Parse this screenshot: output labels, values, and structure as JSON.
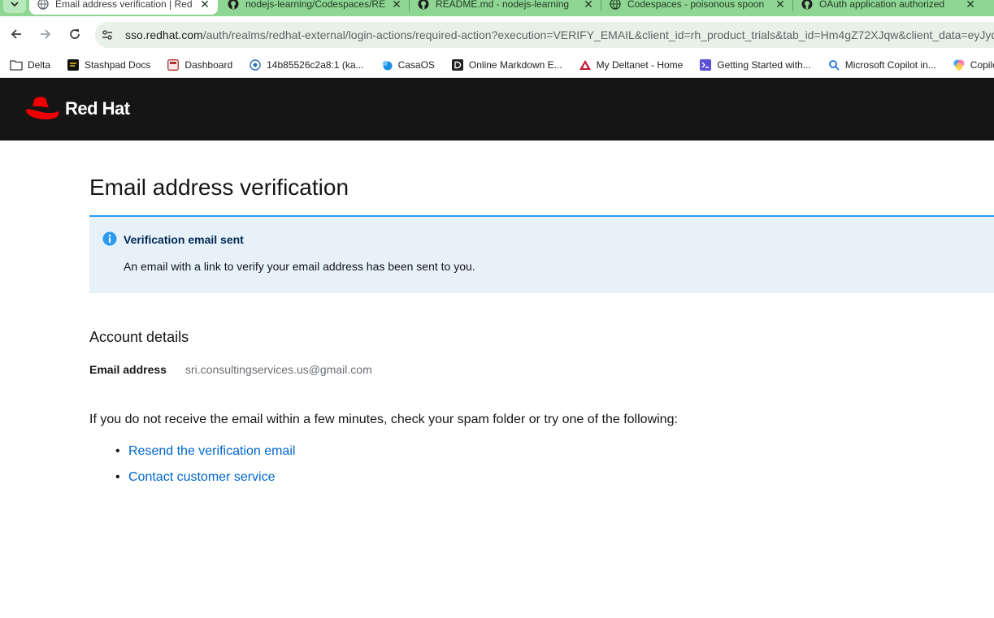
{
  "browser": {
    "tabs": [
      {
        "label": "Email address verification | Red Hat",
        "active": true,
        "icon": "globe-icon"
      },
      {
        "label": "nodejs-learning/Codespaces/README.md",
        "active": false,
        "icon": "github-icon"
      },
      {
        "label": "README.md - nodejs-learning",
        "active": false,
        "icon": "github-icon"
      },
      {
        "label": "Codespaces - poisonous spoon",
        "active": false,
        "icon": "github-icon"
      },
      {
        "label": "OAuth application authorized",
        "active": false,
        "icon": "github-icon"
      }
    ],
    "close_glyph": "✕",
    "url_host": "sso.redhat.com",
    "url_path": "/auth/realms/redhat-external/login-actions/required-action?execution=VERIFY_EMAIL&client_id=rh_product_trials&tab_id=Hm4gZ72XJqw&client_data=eyJyd",
    "bookmarks": [
      {
        "label": "Delta",
        "icon": "folder-icon"
      },
      {
        "label": "Stashpad Docs",
        "icon": "stashpad-icon"
      },
      {
        "label": "Dashboard",
        "icon": "dashboard-icon"
      },
      {
        "label": "14b85526c2a8:1 (ka...",
        "icon": "vnc-icon"
      },
      {
        "label": "CasaOS",
        "icon": "casaos-icon"
      },
      {
        "label": "Online Markdown E...",
        "icon": "markdown-icon"
      },
      {
        "label": "My Deltanet - Home",
        "icon": "delta-icon"
      },
      {
        "label": "Getting Started with...",
        "icon": "terminal-icon"
      },
      {
        "label": "Microsoft Copilot in...",
        "icon": "search-icon"
      },
      {
        "label": "Copilot",
        "icon": "copilot-icon"
      }
    ]
  },
  "header": {
    "logo_text": "Red Hat"
  },
  "content": {
    "title": "Email address verification",
    "alert": {
      "title": "Verification email sent",
      "body": "An email with a link to verify your email address has been sent to you."
    },
    "account_section_title": "Account details",
    "email_label": "Email address",
    "email_value": "sri.consultingservices.us@gmail.com",
    "help_text": "If you do not receive the email within a few minutes, check your spam folder or try one of the following:",
    "links": [
      "Resend the verification email",
      "Contact customer service"
    ]
  },
  "colors": {
    "tabstrip": "#8fd694",
    "header_bg": "#151515",
    "alert_bg": "#e7f1fa",
    "alert_border": "#2b9af3",
    "link": "#0066cc",
    "redhat_red": "#ee0000"
  }
}
